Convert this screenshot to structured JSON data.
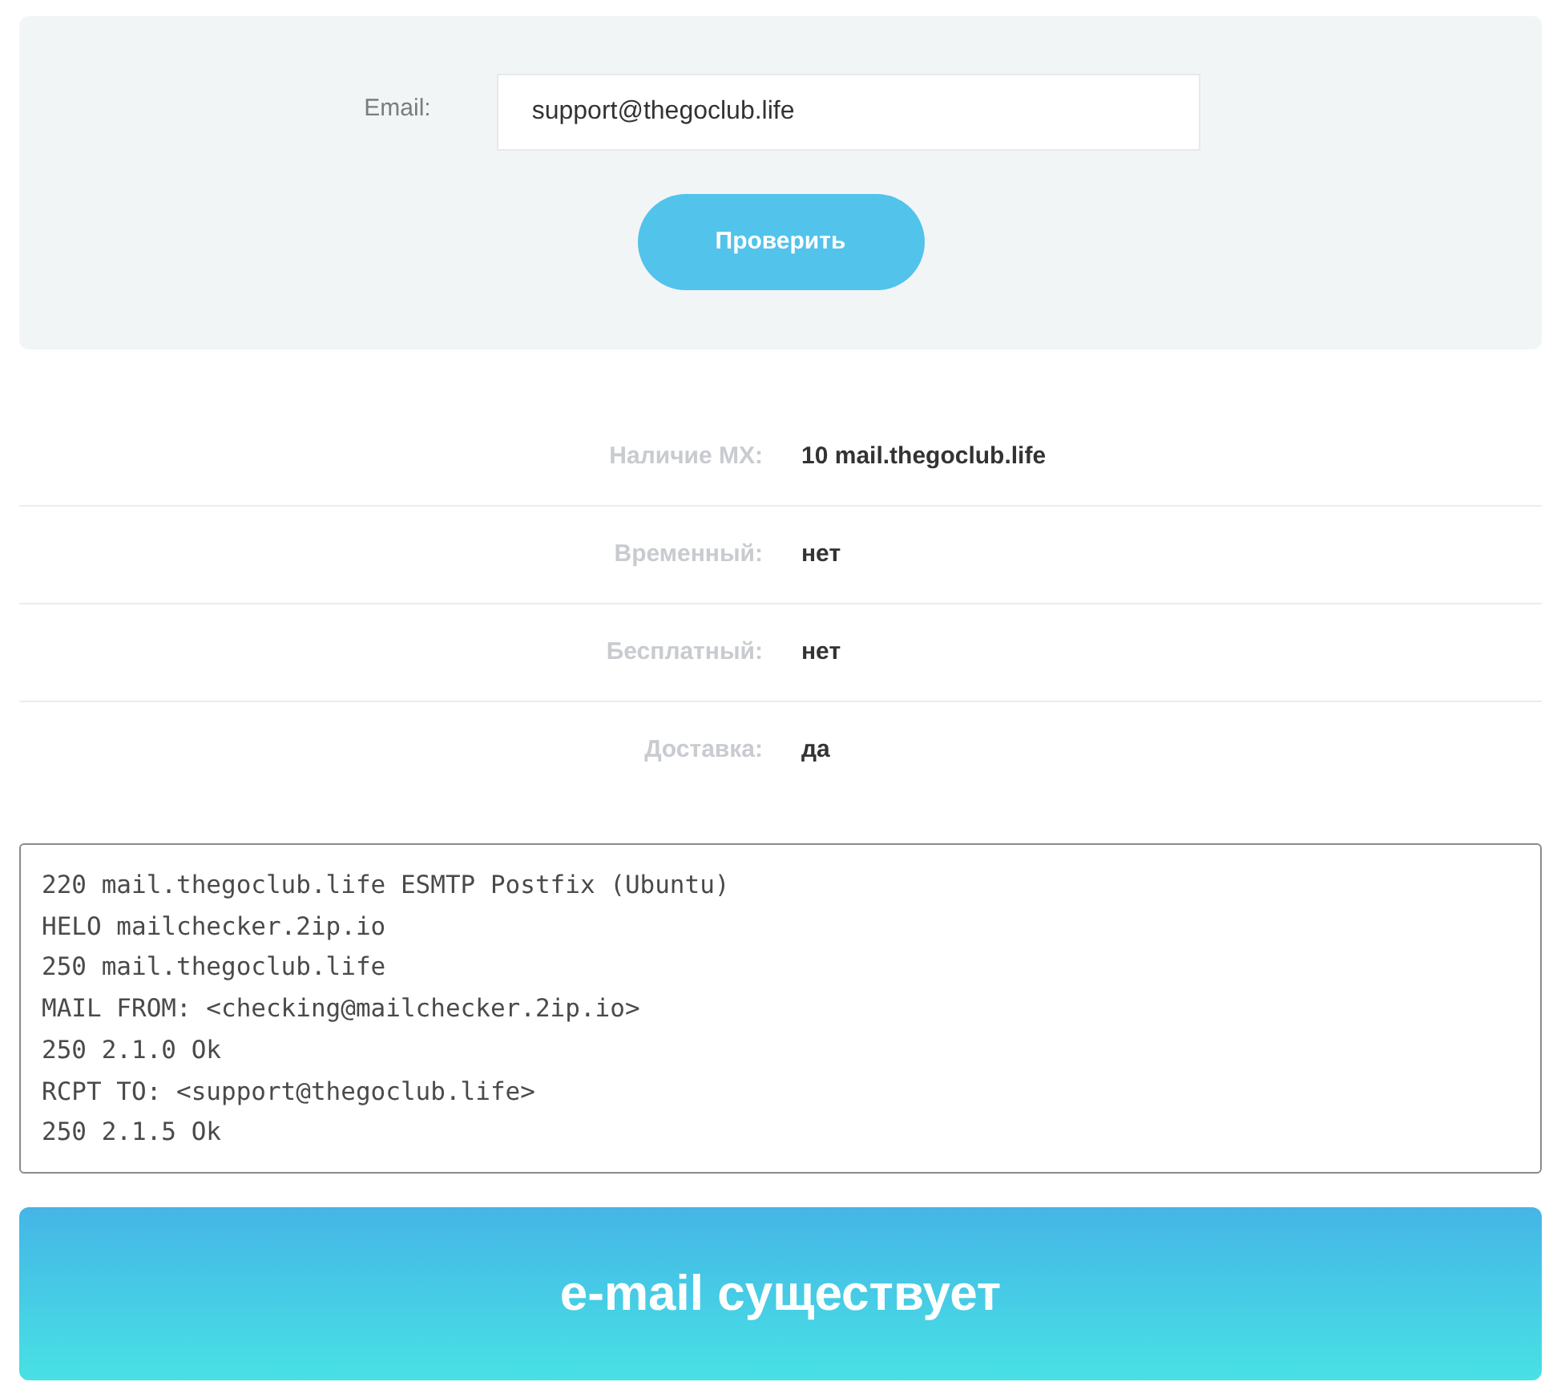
{
  "form": {
    "email_label": "Email:",
    "email_value": "support@thegoclub.life",
    "submit": "Проверить"
  },
  "results": [
    {
      "label": "Наличие MX:",
      "value": "10 mail.thegoclub.life"
    },
    {
      "label": "Временный:",
      "value": "нет"
    },
    {
      "label": "Бесплатный:",
      "value": "нет"
    },
    {
      "label": "Доставка:",
      "value": "да"
    }
  ],
  "smtp_log": [
    "220 mail.thegoclub.life ESMTP Postfix (Ubuntu)",
    "HELO mailchecker.2ip.io",
    "250 mail.thegoclub.life",
    "MAIL FROM: <checking@mailchecker.2ip.io>",
    "250 2.1.0 Ok",
    "RCPT TO: <support@thegoclub.life>",
    "250 2.1.5 Ok"
  ],
  "verdict": {
    "text": "e-mail существует",
    "kind": "success"
  }
}
